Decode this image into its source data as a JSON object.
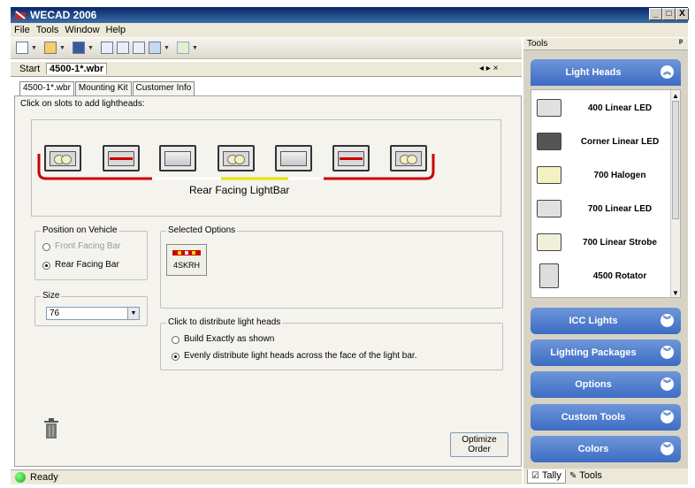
{
  "window": {
    "title": "WECAD 2006",
    "controls": [
      "_",
      "□",
      "X"
    ]
  },
  "menu": [
    "File",
    "Tools",
    "Window",
    "Help"
  ],
  "doc_tabs": {
    "start": "Start",
    "file": "4500-1*.wbr",
    "nav": "◂ ▸ ×"
  },
  "inner_tabs": [
    "4500-1*.wbr",
    "Mounting Kit",
    "Customer Info"
  ],
  "main": {
    "instruction": "Click on slots to add lightheads:",
    "lightbar_label": "Rear Facing LightBar",
    "slots": [
      "halogen",
      "red",
      "empty",
      "halogen",
      "empty",
      "red",
      "halogen"
    ],
    "position": {
      "title": "Position on Vehicle",
      "front": "Front Facing Bar",
      "rear": "Rear Facing Bar",
      "selected": "rear"
    },
    "size": {
      "title": "Size",
      "value": "76"
    },
    "selected_options": {
      "title": "Selected Options",
      "item": "4SKRH"
    },
    "distribute": {
      "title": "Click to distribute light heads",
      "opt1": "Build Exactly as shown",
      "opt2": "Evenly distribute light heads across the face of the light bar.",
      "selected": "opt2"
    },
    "optimize_button": [
      "Optimize",
      "Order"
    ]
  },
  "tools": {
    "header": "Tools",
    "pin": "ᵖ",
    "light_heads": {
      "title": "Light Heads",
      "items": [
        "400 Linear LED",
        "Corner Linear LED",
        "700 Halogen",
        "700 Linear LED",
        "700 Linear Strobe",
        "4500 Rotator"
      ]
    },
    "categories": [
      "ICC Lights",
      "Lighting Packages",
      "Options",
      "Custom Tools",
      "Colors"
    ],
    "bottom_tabs": [
      "Tally",
      "Tools"
    ]
  },
  "status": "Ready",
  "colors": {
    "accent_blue": "#3c6cc4",
    "lightbar_red": "#cc0000",
    "title_blue": "#0a246a"
  }
}
